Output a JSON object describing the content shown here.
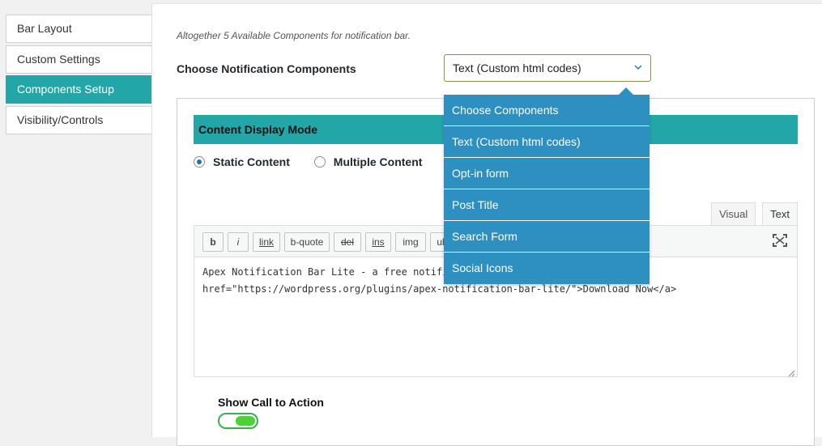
{
  "sidebar": {
    "tabs": [
      {
        "label": "Bar Layout",
        "active": false
      },
      {
        "label": "Custom Settings",
        "active": false
      },
      {
        "label": "Components Setup",
        "active": true
      },
      {
        "label": "Visibility/Controls",
        "active": false
      }
    ]
  },
  "main": {
    "hint": "Altogether 5 Available Components for notification bar.",
    "choose_label": "Choose Notification Components",
    "select_value": "Text (Custom html codes)"
  },
  "card": {
    "section_title": "Content Display Mode",
    "radio_static": "Static Content",
    "radio_multiple": "Multiple Content"
  },
  "editor": {
    "tab_visual": "Visual",
    "tab_text": "Text",
    "quicktags": {
      "b": "b",
      "i": "i",
      "link": "link",
      "bquote": "b-quote",
      "del": "del",
      "ins": "ins",
      "img": "img",
      "ul": "ul"
    },
    "line1": "Apex Notification Bar Lite - a free notifi",
    "line2": "href=\"https://wordpress.org/plugins/apex-notification-bar-lite/\">Download Now</a>"
  },
  "cta": {
    "label": "Show Call to Action",
    "enabled": true
  },
  "dropdown": {
    "options": [
      "Choose Components",
      "Text (Custom html codes)",
      "Opt-in form",
      "Post Title",
      "Search Form",
      "Social Icons"
    ]
  },
  "colors": {
    "accent": "#23a6a8",
    "dropdown_bg": "#2e8fc1",
    "toggle_on": "#4cd137"
  }
}
